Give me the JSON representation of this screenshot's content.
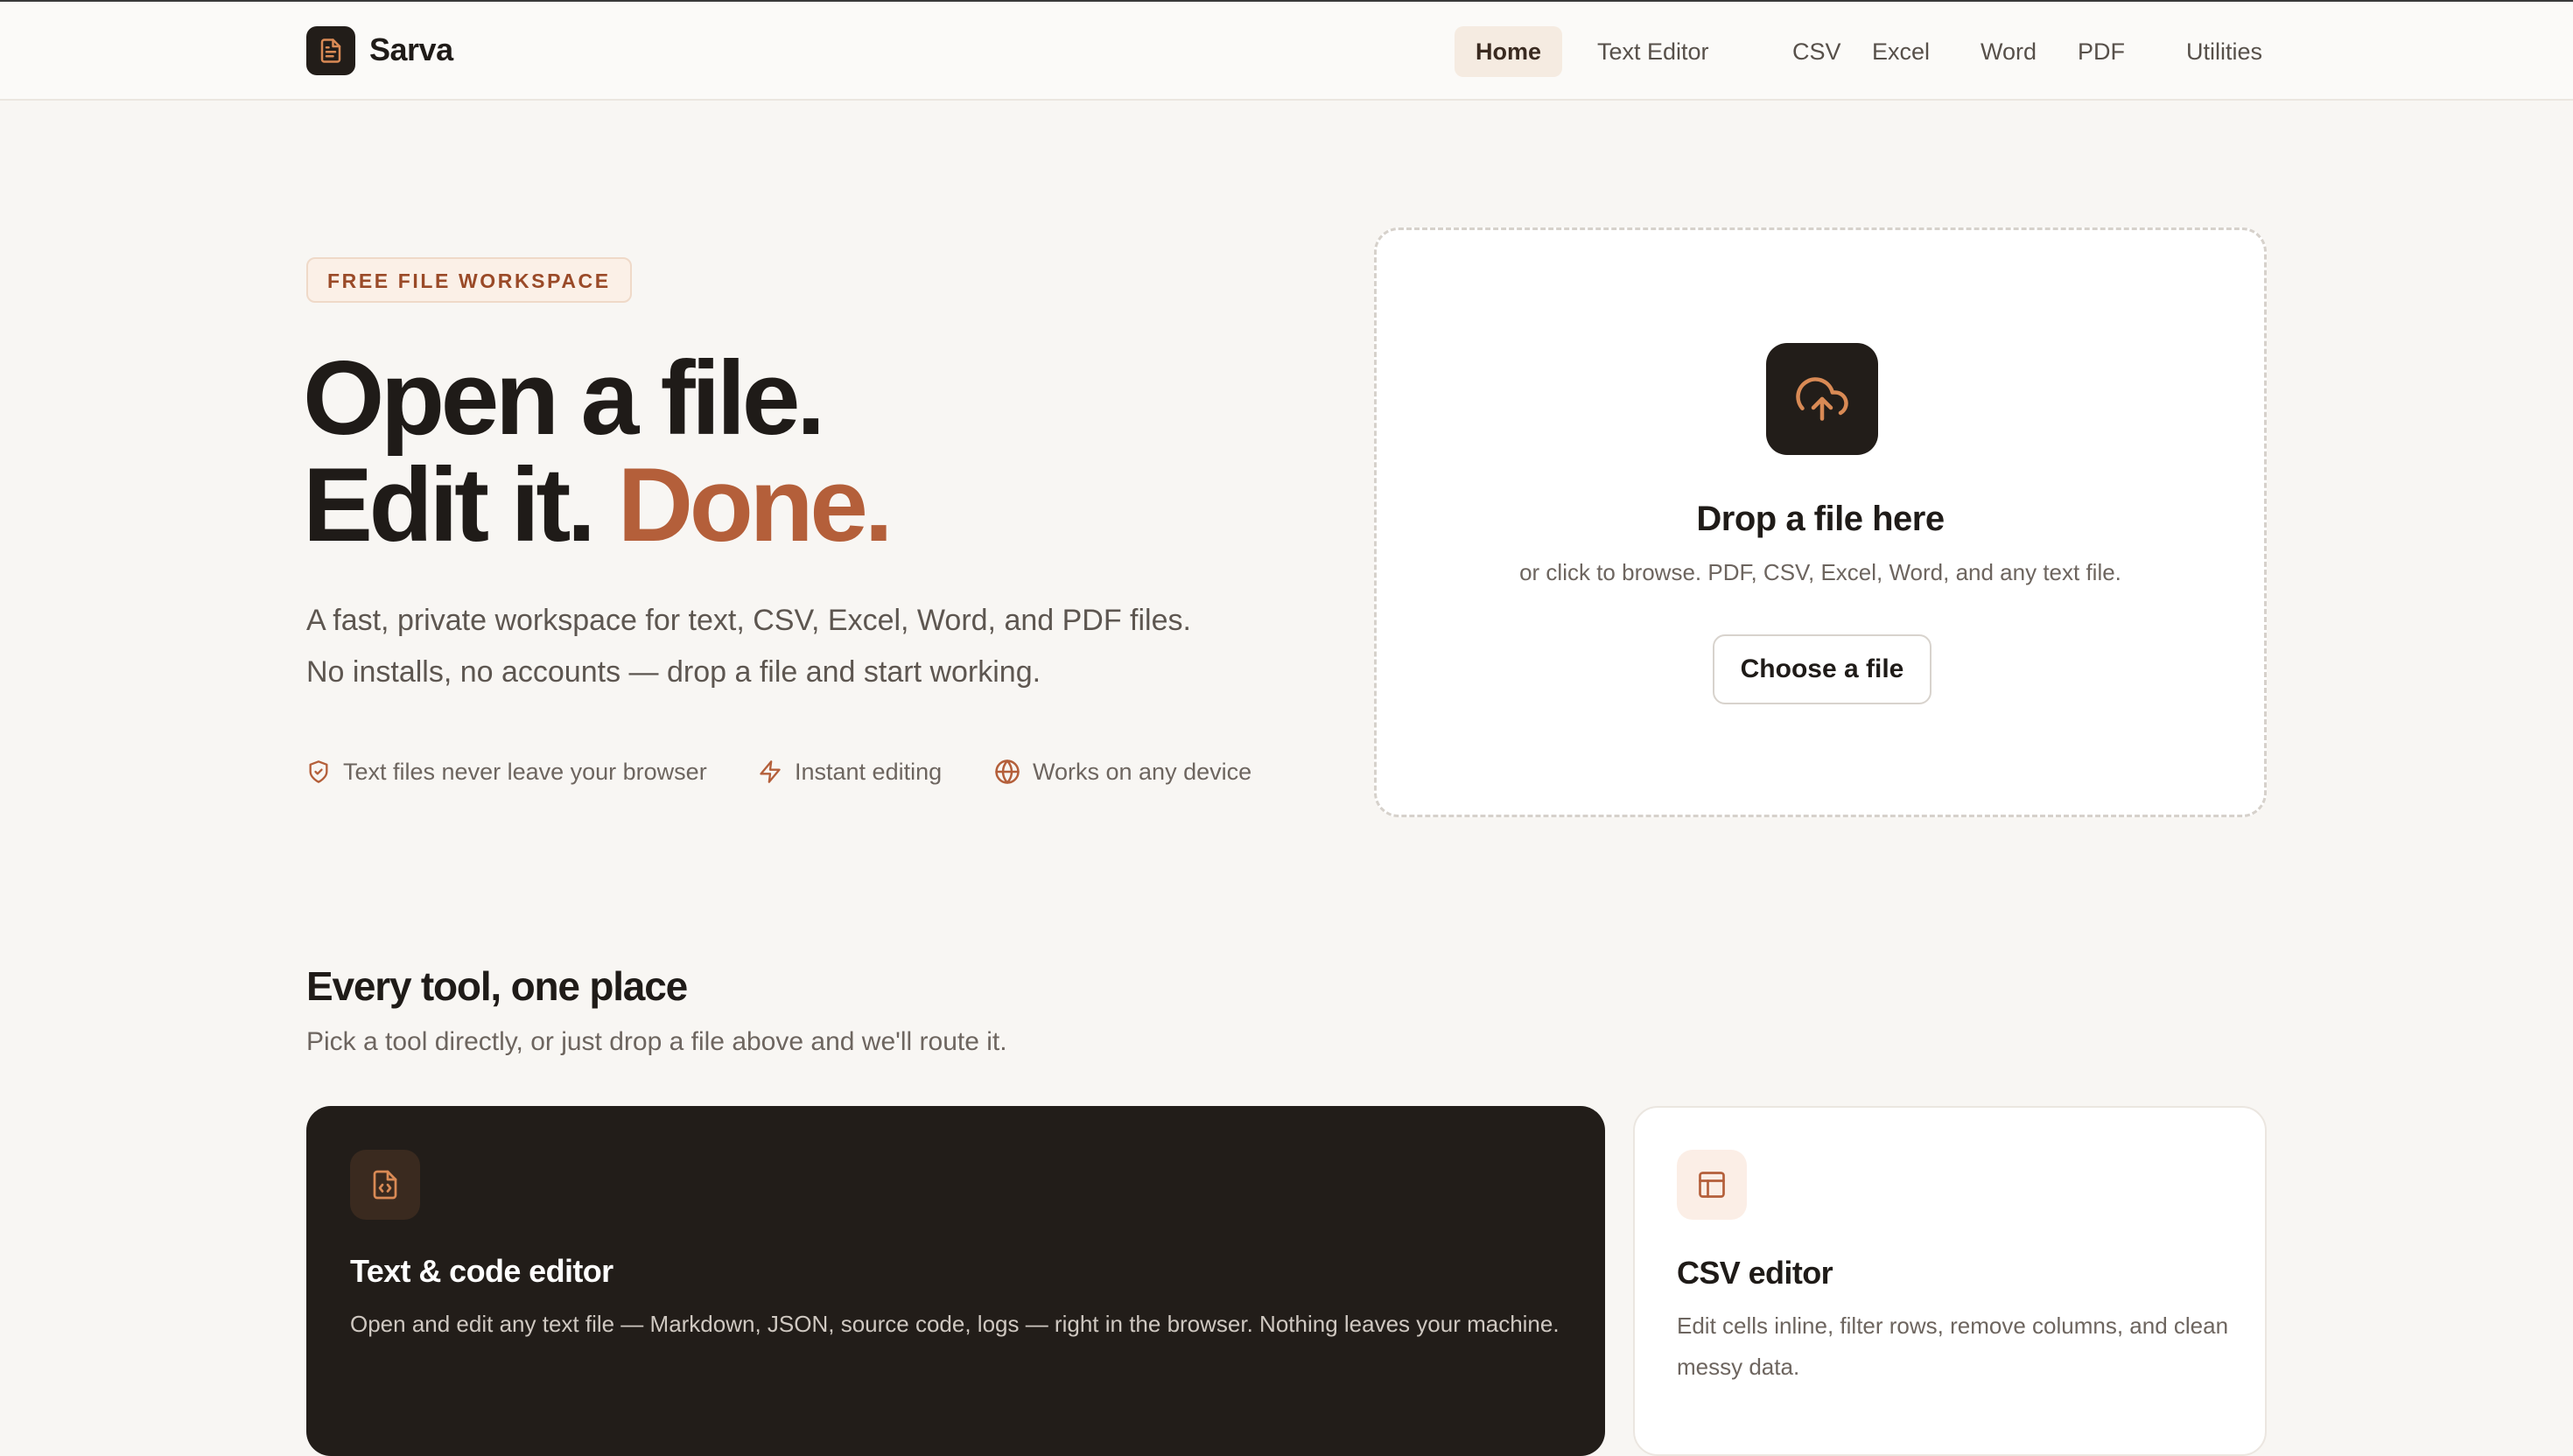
{
  "app": {
    "name": "Sarva"
  },
  "nav": {
    "items": [
      {
        "label": "Home",
        "active": true
      },
      {
        "label": "Text Editor",
        "active": false
      },
      {
        "label": "CSV",
        "active": false
      },
      {
        "label": "Excel",
        "active": false
      },
      {
        "label": "Word",
        "active": false
      },
      {
        "label": "PDF",
        "active": false
      },
      {
        "label": "Utilities",
        "active": false
      }
    ]
  },
  "hero": {
    "badge": "FREE FILE WORKSPACE",
    "title_line1": "Open a file.",
    "title_line2_prefix": "Edit it.",
    "title_line2_accent": "Done.",
    "description": "A fast, private workspace for text, CSV, Excel, Word, and PDF files. No installs, no accounts — drop a file and start working.",
    "features": [
      {
        "icon": "shield-check-icon",
        "label": "Text files never leave your browser"
      },
      {
        "icon": "lightning-icon",
        "label": "Instant editing"
      },
      {
        "icon": "globe-icon",
        "label": "Works on any device"
      }
    ]
  },
  "dropzone": {
    "icon": "cloud-upload-icon",
    "title": "Drop a file here",
    "subtitle": "or click to browse. PDF, CSV, Excel, Word, and any text file.",
    "button_label": "Choose a file"
  },
  "tools": {
    "title": "Every tool, one place",
    "subtitle": "Pick a tool directly, or just drop a file above and we'll route it.",
    "cards": [
      {
        "icon": "code-file-icon",
        "title": "Text & code editor",
        "description": "Open and edit any text file — Markdown, JSON, source code, logs — right in the browser. Nothing leaves your machine."
      },
      {
        "icon": "table-icon",
        "title": "CSV editor",
        "description": "Edit cells inline, filter rows, remove columns, and clean messy data."
      }
    ]
  },
  "colors": {
    "accent": "#b45f3a",
    "dark": "#221d19",
    "background": "#f8f6f3",
    "badge_text": "#9a4a28"
  }
}
